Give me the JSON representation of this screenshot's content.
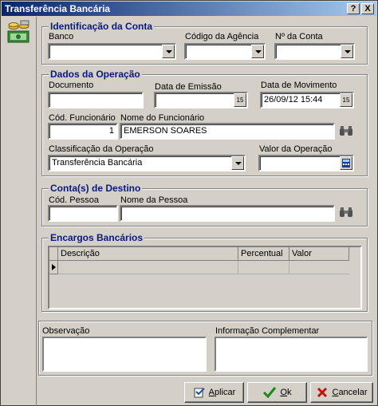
{
  "window": {
    "title": "Transferência Bancária",
    "help_label": "?",
    "close_label": "X"
  },
  "conta": {
    "title": "Identificação da Conta",
    "banco_label": "Banco",
    "banco_value": "",
    "agencia_label": "Código da Agência",
    "agencia_value": "",
    "numero_label": "Nº da Conta",
    "numero_value": ""
  },
  "operacao": {
    "title": "Dados da Operação",
    "documento_label": "Documento",
    "documento_value": "",
    "emissao_label": "Data de Emissão",
    "emissao_value": "",
    "movimento_label": "Data de Movimento",
    "movimento_value": "26/09/12 15:44",
    "calendar_icon_text": "15",
    "cod_func_label": "Cód. Funcionário",
    "cod_func_value": "1",
    "nome_func_label": "Nome do Funcionário",
    "nome_func_value": "EMERSON SOARES",
    "classif_label": "Classificação da Operação",
    "classif_value": "Transferência Bancária",
    "valor_label": "Valor da Operação",
    "valor_value": ""
  },
  "destino": {
    "title": "Conta(s) de Destino",
    "cod_pessoa_label": "Cód. Pessoa",
    "cod_pessoa_value": "",
    "nome_pessoa_label": "Nome da Pessoa",
    "nome_pessoa_value": ""
  },
  "encargos": {
    "title": "Encargos Bancários",
    "columns": [
      "Descrição",
      "Percentual",
      "Valor"
    ]
  },
  "observacao_label": "Observação",
  "info_label": "Informação Complementar",
  "buttons": {
    "aplicar_prefix": "",
    "aplicar_accel": "A",
    "aplicar_rest": "plicar",
    "ok_accel": "O",
    "ok_rest": "k",
    "cancelar_accel": "C",
    "cancelar_rest": "ancelar"
  }
}
